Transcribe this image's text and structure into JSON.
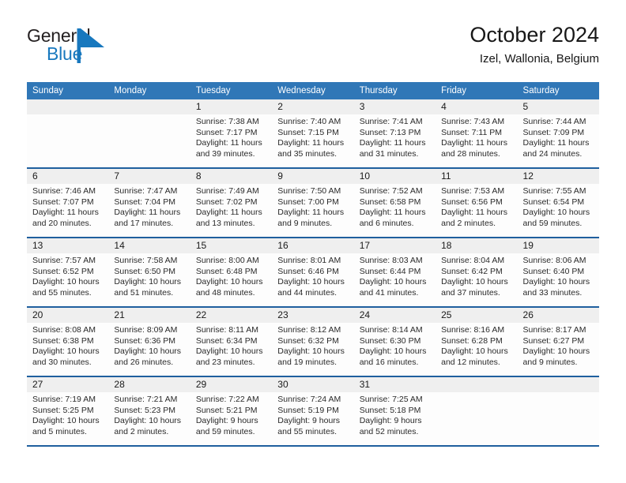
{
  "brand": {
    "name_top": "General",
    "name_bottom": "Blue",
    "mark": "blue-triangle-flag-icon",
    "color_top": "#231f20",
    "color_bottom": "#1878be"
  },
  "header": {
    "title": "October 2024",
    "subtitle": "Izel, Wallonia, Belgium"
  },
  "theme": {
    "header_blue": "#3077b7",
    "rule_blue": "#1f5f9e",
    "daynum_band": "#efefef"
  },
  "weekdays": [
    "Sunday",
    "Monday",
    "Tuesday",
    "Wednesday",
    "Thursday",
    "Friday",
    "Saturday"
  ],
  "labels": {
    "sunrise_prefix": "Sunrise:",
    "sunset_prefix": "Sunset:",
    "daylight_prefix": "Daylight:"
  },
  "weeks": [
    {
      "days": [
        {
          "num": "",
          "empty": true
        },
        {
          "num": "",
          "empty": true
        },
        {
          "num": "1",
          "sunrise": "Sunrise: 7:38 AM",
          "sunset": "Sunset: 7:17 PM",
          "daylight": "Daylight: 11 hours and 39 minutes."
        },
        {
          "num": "2",
          "sunrise": "Sunrise: 7:40 AM",
          "sunset": "Sunset: 7:15 PM",
          "daylight": "Daylight: 11 hours and 35 minutes."
        },
        {
          "num": "3",
          "sunrise": "Sunrise: 7:41 AM",
          "sunset": "Sunset: 7:13 PM",
          "daylight": "Daylight: 11 hours and 31 minutes."
        },
        {
          "num": "4",
          "sunrise": "Sunrise: 7:43 AM",
          "sunset": "Sunset: 7:11 PM",
          "daylight": "Daylight: 11 hours and 28 minutes."
        },
        {
          "num": "5",
          "sunrise": "Sunrise: 7:44 AM",
          "sunset": "Sunset: 7:09 PM",
          "daylight": "Daylight: 11 hours and 24 minutes."
        }
      ]
    },
    {
      "days": [
        {
          "num": "6",
          "sunrise": "Sunrise: 7:46 AM",
          "sunset": "Sunset: 7:07 PM",
          "daylight": "Daylight: 11 hours and 20 minutes."
        },
        {
          "num": "7",
          "sunrise": "Sunrise: 7:47 AM",
          "sunset": "Sunset: 7:04 PM",
          "daylight": "Daylight: 11 hours and 17 minutes."
        },
        {
          "num": "8",
          "sunrise": "Sunrise: 7:49 AM",
          "sunset": "Sunset: 7:02 PM",
          "daylight": "Daylight: 11 hours and 13 minutes."
        },
        {
          "num": "9",
          "sunrise": "Sunrise: 7:50 AM",
          "sunset": "Sunset: 7:00 PM",
          "daylight": "Daylight: 11 hours and 9 minutes."
        },
        {
          "num": "10",
          "sunrise": "Sunrise: 7:52 AM",
          "sunset": "Sunset: 6:58 PM",
          "daylight": "Daylight: 11 hours and 6 minutes."
        },
        {
          "num": "11",
          "sunrise": "Sunrise: 7:53 AM",
          "sunset": "Sunset: 6:56 PM",
          "daylight": "Daylight: 11 hours and 2 minutes."
        },
        {
          "num": "12",
          "sunrise": "Sunrise: 7:55 AM",
          "sunset": "Sunset: 6:54 PM",
          "daylight": "Daylight: 10 hours and 59 minutes."
        }
      ]
    },
    {
      "days": [
        {
          "num": "13",
          "sunrise": "Sunrise: 7:57 AM",
          "sunset": "Sunset: 6:52 PM",
          "daylight": "Daylight: 10 hours and 55 minutes."
        },
        {
          "num": "14",
          "sunrise": "Sunrise: 7:58 AM",
          "sunset": "Sunset: 6:50 PM",
          "daylight": "Daylight: 10 hours and 51 minutes."
        },
        {
          "num": "15",
          "sunrise": "Sunrise: 8:00 AM",
          "sunset": "Sunset: 6:48 PM",
          "daylight": "Daylight: 10 hours and 48 minutes."
        },
        {
          "num": "16",
          "sunrise": "Sunrise: 8:01 AM",
          "sunset": "Sunset: 6:46 PM",
          "daylight": "Daylight: 10 hours and 44 minutes."
        },
        {
          "num": "17",
          "sunrise": "Sunrise: 8:03 AM",
          "sunset": "Sunset: 6:44 PM",
          "daylight": "Daylight: 10 hours and 41 minutes."
        },
        {
          "num": "18",
          "sunrise": "Sunrise: 8:04 AM",
          "sunset": "Sunset: 6:42 PM",
          "daylight": "Daylight: 10 hours and 37 minutes."
        },
        {
          "num": "19",
          "sunrise": "Sunrise: 8:06 AM",
          "sunset": "Sunset: 6:40 PM",
          "daylight": "Daylight: 10 hours and 33 minutes."
        }
      ]
    },
    {
      "days": [
        {
          "num": "20",
          "sunrise": "Sunrise: 8:08 AM",
          "sunset": "Sunset: 6:38 PM",
          "daylight": "Daylight: 10 hours and 30 minutes."
        },
        {
          "num": "21",
          "sunrise": "Sunrise: 8:09 AM",
          "sunset": "Sunset: 6:36 PM",
          "daylight": "Daylight: 10 hours and 26 minutes."
        },
        {
          "num": "22",
          "sunrise": "Sunrise: 8:11 AM",
          "sunset": "Sunset: 6:34 PM",
          "daylight": "Daylight: 10 hours and 23 minutes."
        },
        {
          "num": "23",
          "sunrise": "Sunrise: 8:12 AM",
          "sunset": "Sunset: 6:32 PM",
          "daylight": "Daylight: 10 hours and 19 minutes."
        },
        {
          "num": "24",
          "sunrise": "Sunrise: 8:14 AM",
          "sunset": "Sunset: 6:30 PM",
          "daylight": "Daylight: 10 hours and 16 minutes."
        },
        {
          "num": "25",
          "sunrise": "Sunrise: 8:16 AM",
          "sunset": "Sunset: 6:28 PM",
          "daylight": "Daylight: 10 hours and 12 minutes."
        },
        {
          "num": "26",
          "sunrise": "Sunrise: 8:17 AM",
          "sunset": "Sunset: 6:27 PM",
          "daylight": "Daylight: 10 hours and 9 minutes."
        }
      ]
    },
    {
      "days": [
        {
          "num": "27",
          "sunrise": "Sunrise: 7:19 AM",
          "sunset": "Sunset: 5:25 PM",
          "daylight": "Daylight: 10 hours and 5 minutes."
        },
        {
          "num": "28",
          "sunrise": "Sunrise: 7:21 AM",
          "sunset": "Sunset: 5:23 PM",
          "daylight": "Daylight: 10 hours and 2 minutes."
        },
        {
          "num": "29",
          "sunrise": "Sunrise: 7:22 AM",
          "sunset": "Sunset: 5:21 PM",
          "daylight": "Daylight: 9 hours and 59 minutes."
        },
        {
          "num": "30",
          "sunrise": "Sunrise: 7:24 AM",
          "sunset": "Sunset: 5:19 PM",
          "daylight": "Daylight: 9 hours and 55 minutes."
        },
        {
          "num": "31",
          "sunrise": "Sunrise: 7:25 AM",
          "sunset": "Sunset: 5:18 PM",
          "daylight": "Daylight: 9 hours and 52 minutes."
        },
        {
          "num": "",
          "empty": true
        },
        {
          "num": "",
          "empty": true
        }
      ]
    }
  ]
}
